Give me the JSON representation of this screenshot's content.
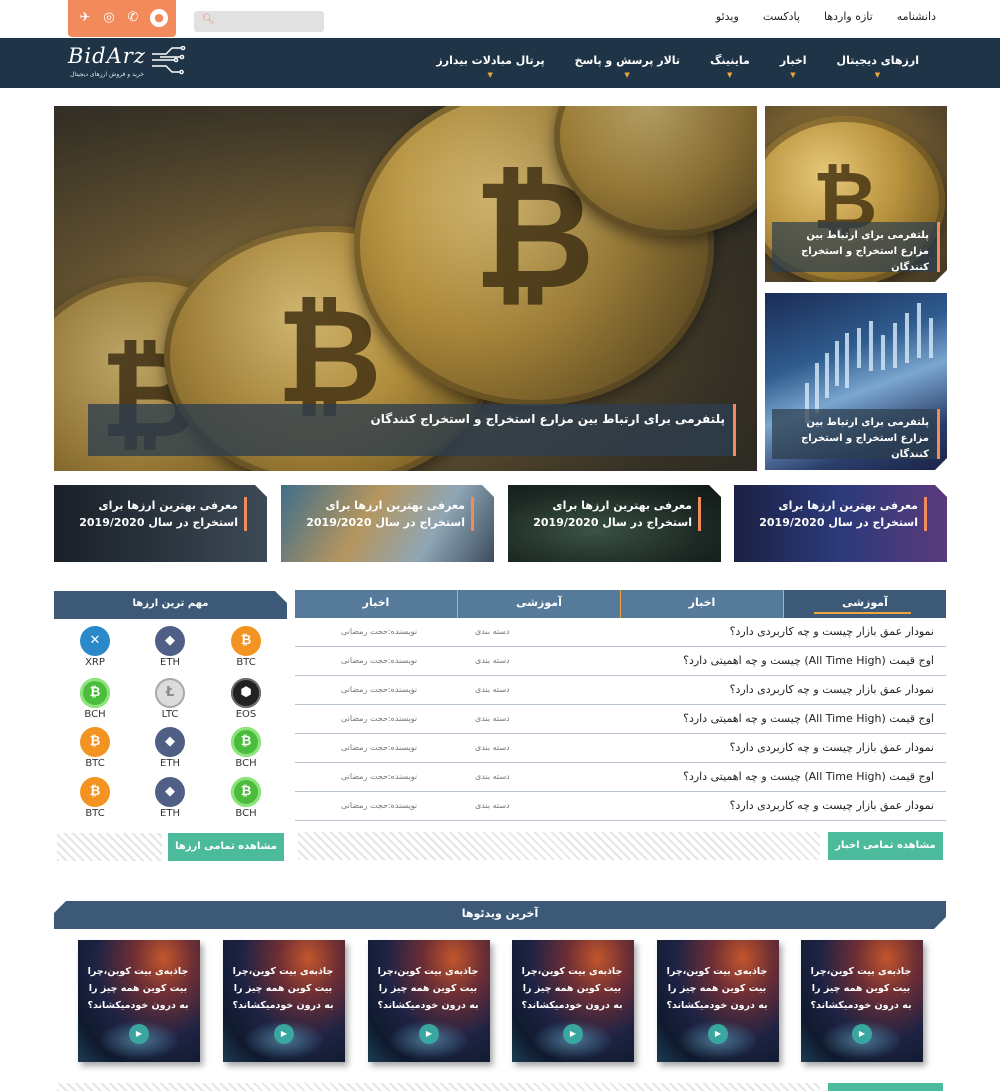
{
  "topbar": {
    "search_placeholder": "",
    "links": [
      "دانشنامه",
      "تازه واردها",
      "پادکست",
      "ویدئو"
    ]
  },
  "nav": {
    "logo_text": "BidArz",
    "logo_tagline": "خرید و فروش ارزهای دیجیتال",
    "items": [
      "ارزهای دیجیتال",
      "اخبار",
      "ماینینگ",
      "تالار پرسش و پاسخ",
      "پرتال مبادلات بیدارز"
    ]
  },
  "hero": {
    "caption": "پلتفرمی برای ارتباط بین مزارع استخراج و استخراج کنندگان",
    "side": [
      "پلتفرمی برای ارتباط بین مزارع استخراج و استخراج کنندگان",
      "پلتفرمی برای ارتباط بین مزارع استخراج و استخراج کنندگان"
    ]
  },
  "cards": [
    "معرفی بهترین ارزها برای استخراج در سال 2019/2020",
    "معرفی بهترین ارزها برای استخراج در سال 2019/2020",
    "معرفی بهترین ارزها برای استخراج در سال 2019/2020",
    "معرفی بهترین ارزها برای استخراج در سال 2019/2020"
  ],
  "currencies": {
    "title": "مهم ترین ارزها",
    "items": [
      "BTC",
      "ETH",
      "XRP",
      "EOS",
      "LTC",
      "BCH",
      "BCH",
      "ETH",
      "BTC",
      "BCH",
      "ETH",
      "BTC"
    ],
    "view_all": "مشاهده تمامی ارزها"
  },
  "posts": {
    "tabs": [
      "آموزشی",
      "اخبار",
      "آموزشی",
      "اخبار"
    ],
    "rows": [
      {
        "title": "نمودار عمق بازار چیست و چه کاربردی دارد؟",
        "category": "دسته بندی",
        "author": "نویسنده:حجت رمضانی"
      },
      {
        "title": "اوج قیمت (All Time High) چیست و چه اهمیتی دارد؟",
        "category": "دسته بندی",
        "author": "نویسنده:حجت رمضانی"
      },
      {
        "title": "نمودار عمق بازار چیست و چه کاربردی دارد؟",
        "category": "دسته بندی",
        "author": "نویسنده:حجت رمضانی"
      },
      {
        "title": "اوج قیمت (All Time High) چیست و چه اهمیتی دارد؟",
        "category": "دسته بندی",
        "author": "نویسنده:حجت رمضانی"
      },
      {
        "title": "نمودار عمق بازار چیست و چه کاربردی دارد؟",
        "category": "دسته بندی",
        "author": "نویسنده:حجت رمضانی"
      },
      {
        "title": "اوج قیمت (All Time High) چیست و چه اهمیتی دارد؟",
        "category": "دسته بندی",
        "author": "نویسنده:حجت رمضانی"
      },
      {
        "title": "نمودار عمق بازار چیست و چه کاربردی دارد؟",
        "category": "دسته بندی",
        "author": "نویسنده:حجت رمضانی"
      }
    ],
    "view_all": "مشاهده تمامی اخبار"
  },
  "videos": {
    "title": "آخرین ویدئوها",
    "items": [
      "جاذبه‌ی بیت کوین،چرا بیت کوین همه چیز را به درون خودمیکشاند؟",
      "جاذبه‌ی بیت کوین،چرا بیت کوین همه چیز را به درون خودمیکشاند؟",
      "جاذبه‌ی بیت کوین،چرا بیت کوین همه چیز را به درون خودمیکشاند؟",
      "جاذبه‌ی بیت کوین،چرا بیت کوین همه چیز را به درون خودمیکشاند؟",
      "جاذبه‌ی بیت کوین،چرا بیت کوین همه چیز را به درون خودمیکشاند؟",
      "جاذبه‌ی بیت کوین،چرا بیت کوین همه چیز را به درون خودمیکشاند؟"
    ]
  },
  "colors": {
    "navy": "#1f3547",
    "panel": "#3c5a78",
    "orange": "#f28a5b",
    "green": "#4cbb9c"
  }
}
